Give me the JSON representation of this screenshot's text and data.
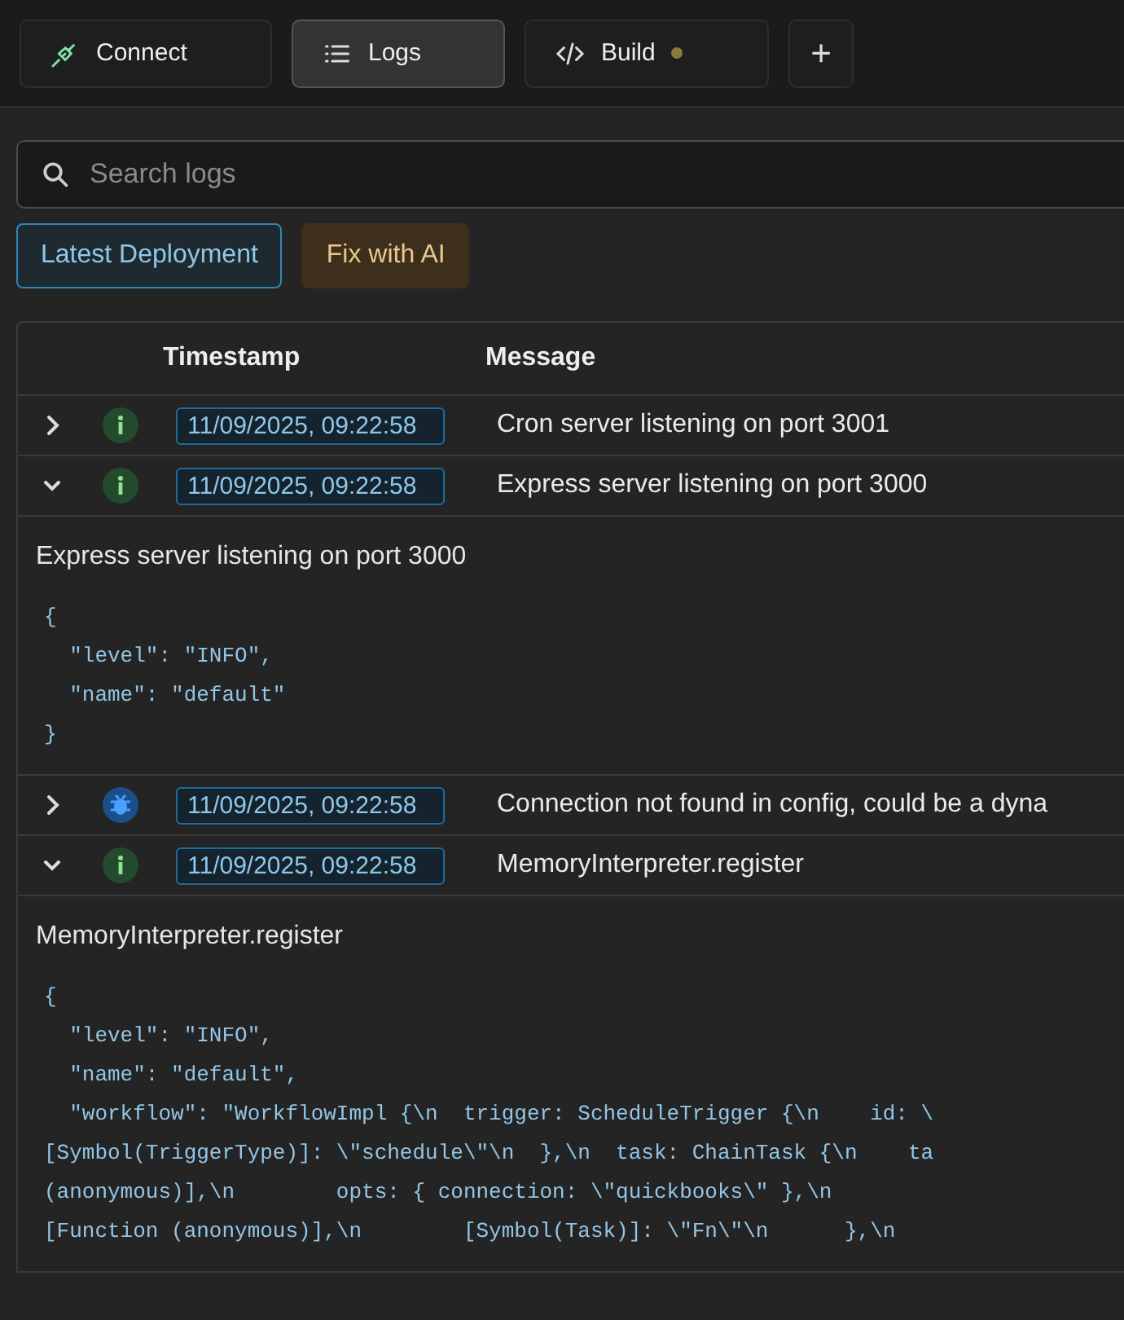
{
  "tabs": [
    {
      "label": "Connect",
      "kind": "plug",
      "selected": false,
      "dot": false
    },
    {
      "label": "Logs",
      "kind": "list",
      "selected": true,
      "dot": false
    },
    {
      "label": "Build",
      "kind": "code",
      "selected": false,
      "dot": true
    }
  ],
  "add_tab": "+",
  "search": {
    "placeholder": "Search logs"
  },
  "actions": [
    {
      "label": "Latest Deployment",
      "kind": "outline"
    },
    {
      "label": "Fix with AI",
      "kind": "ai"
    }
  ],
  "table": {
    "columns": [
      "Timestamp",
      "Message"
    ],
    "rows": [
      {
        "expanded": false,
        "kind": "info",
        "timestamp": "11/09/2025, 09:22:58",
        "message": "Cron server listening on port 3001"
      },
      {
        "expanded": true,
        "kind": "info",
        "timestamp": "11/09/2025, 09:22:58",
        "message": "Express server listening on port 3000",
        "detail": {
          "title": "Express server listening on port 3000",
          "code": [
            "{",
            "  \"level\": \"INFO\",",
            "  \"name\": \"default\"",
            "}"
          ]
        }
      },
      {
        "expanded": false,
        "kind": "debug",
        "timestamp": "11/09/2025, 09:22:58",
        "message": "Connection not found in config, could be a dyna"
      },
      {
        "expanded": true,
        "kind": "info",
        "timestamp": "11/09/2025, 09:22:58",
        "message": "MemoryInterpreter.register",
        "detail": {
          "title": "MemoryInterpreter.register",
          "code": [
            "{",
            "  \"level\": \"INFO\",",
            "  \"name\": \"default\",",
            "  \"workflow\": \"WorkflowImpl {\\n  trigger: ScheduleTrigger {\\n    id: \\",
            "[Symbol(TriggerType)]: \\\"schedule\\\"\\n  },\\n  task: ChainTask {\\n    ta",
            "(anonymous)],\\n        opts: { connection: \\\"quickbooks\\\" },\\n",
            "[Function (anonymous)],\\n        [Symbol(Task)]: \\\"Fn\\\"\\n      },\\n"
          ]
        }
      }
    ]
  }
}
